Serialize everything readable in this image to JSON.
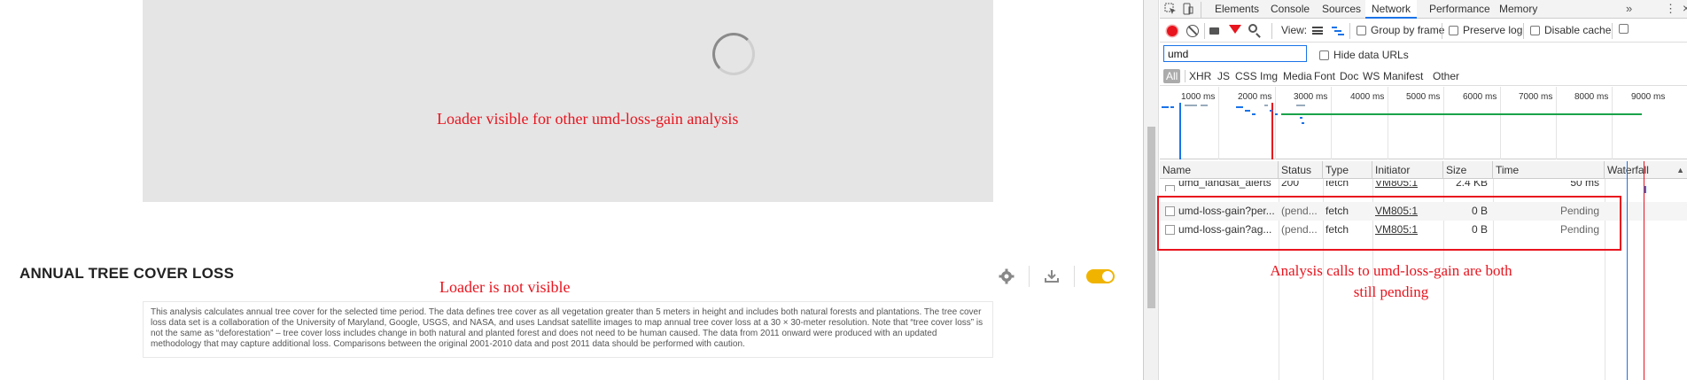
{
  "page": {
    "annotation_loader_visible": "Loader visible for other umd-loss-gain analysis",
    "annotation_loader_not_visible": "Loader is not visible",
    "widget_title": "ANNUAL TREE COVER LOSS",
    "widget_description": "This analysis calculates annual tree cover for the selected time period. The data defines tree cover as all vegetation greater than 5 meters in height and includes both natural forests and plantations. The tree cover loss data set is a collaboration of the University of Maryland, Google, USGS, and NASA, and uses Landsat satellite images to map annual tree cover loss at a 30 × 30-meter resolution. Note that “tree cover loss” is not the same as “deforestation” – tree cover loss includes change in both natural and planted forest and does not need to be human caused. The data from 2011 onward were produced with an updated methodology that may capture additional loss. Comparisons between the original 2001-2010 data and post 2011 data should be performed with caution.",
    "tool_icons": [
      "gear-icon",
      "download-icon",
      "toggle-switch"
    ],
    "toggle_color": "#f0b400"
  },
  "devtools": {
    "tabs": [
      "Elements",
      "Console",
      "Sources",
      "Network",
      "Performance",
      "Memory"
    ],
    "active_tab": "Network",
    "more_tabs": "»",
    "toolbar": {
      "view_label": "View:",
      "group_by_frame": "Group by frame",
      "preserve_log": "Preserve log",
      "disable_cache": "Disable cache"
    },
    "filter_value": "umd",
    "hide_data_urls": "Hide data URLs",
    "type_filters": [
      "All",
      "XHR",
      "JS",
      "CSS",
      "Img",
      "Media",
      "Font",
      "Doc",
      "WS",
      "Manifest",
      "Other"
    ],
    "timeline_labels": [
      "1000 ms",
      "2000 ms",
      "3000 ms",
      "4000 ms",
      "5000 ms",
      "6000 ms",
      "7000 ms",
      "8000 ms",
      "9000 ms"
    ],
    "columns": [
      "Name",
      "Status",
      "Type",
      "Initiator",
      "Size",
      "Time",
      "Waterfall"
    ],
    "rows": [
      {
        "name": "umd_landsat_alerts",
        "status": "200",
        "type": "fetch",
        "initiator": "VM805:1",
        "size": "2.4 KB",
        "time": "50 ms"
      },
      {
        "name": "umd-loss-gain?per...",
        "status": "(pend...",
        "type": "fetch",
        "initiator": "VM805:1",
        "size": "0 B",
        "time": "Pending"
      },
      {
        "name": "umd-loss-gain?ag...",
        "status": "(pend...",
        "type": "fetch",
        "initiator": "VM805:1",
        "size": "0 B",
        "time": "Pending"
      }
    ],
    "annotation_pending": "Analysis calls to umd-loss-gain are both still pending",
    "colors": {
      "accent": "#1a73e8",
      "record": "#e8141e",
      "annotation": "#e8141e",
      "timeline_green": "#1aa34a"
    }
  }
}
